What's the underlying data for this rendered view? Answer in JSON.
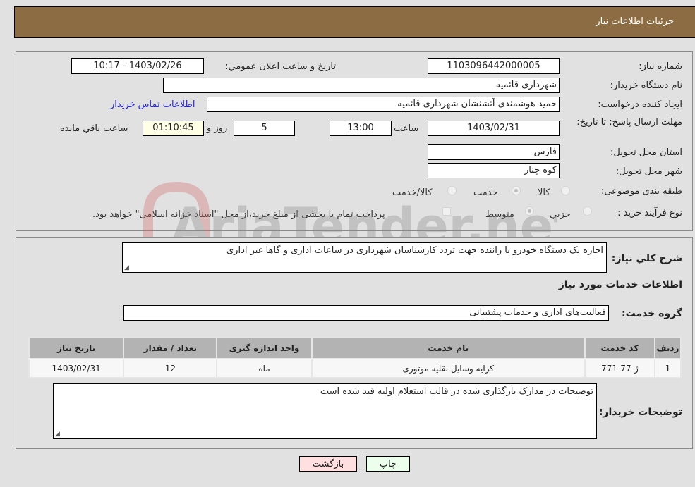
{
  "header": {
    "title": "جزئیات اطلاعات نیاز"
  },
  "fields": {
    "need_number_label": "شماره نیاز:",
    "need_number": "1103096442000005",
    "announce_label": "تاریخ و ساعت اعلان عمومي:",
    "announce_value": "1403/02/26 - 10:17",
    "buyer_name_label": "نام دستگاه خریدار:",
    "buyer_name": "شهرداری قائمیه",
    "creator_label": "ایجاد کننده درخواست:",
    "creator": "حمید هوشمندی آتشنشان شهرداری قائمیه",
    "contact_link": "اطلاعات تماس خریدار",
    "deadline_label": "مهلت ارسال پاسخ: تا تاریخ:",
    "deadline_date": "1403/02/31",
    "time_label": "ساعت",
    "deadline_time": "13:00",
    "days_value": "5",
    "days_label": "روز و",
    "remaining_time": "01:10:45",
    "remaining_label": "ساعت باقي مانده",
    "province_label": "استان محل تحویل:",
    "province": "فارس",
    "city_label": "شهر محل تحویل:",
    "city": "کوه چنار",
    "category_label": "طبقه بندی موضوعی:",
    "category_options": [
      {
        "label": "کالا",
        "checked": false
      },
      {
        "label": "خدمت",
        "checked": true
      },
      {
        "label": "کالا/خدمت",
        "checked": false
      }
    ],
    "process_label": "نوع فرآیند خرید :",
    "process_options": [
      {
        "label": "جزيي",
        "checked": false
      },
      {
        "label": "متوسط",
        "checked": true
      }
    ],
    "treasury_checkbox_label": "پرداخت تمام یا بخشی از مبلغ خرید،از محل \"اسناد خزانه اسلامی\" خواهد بود.",
    "treasury_checked": false
  },
  "details": {
    "summary_label": "شرح کلي نیاز:",
    "summary": "اجاره یک دستگاه خودرو با راننده جهت تردد کارشناسان شهرداری در ساعات اداری و گاها غیر اداری",
    "services_title": "اطلاعات خدمات مورد نیاز",
    "service_group_label": "گروه خدمت:",
    "service_group": "فعالیت‌های اداری و خدمات پشتیبانی",
    "table": {
      "headers": [
        "ردیف",
        "کد خدمت",
        "نام خدمت",
        "واحد اندازه گیری",
        "تعداد / مقدار",
        "تاریخ نیاز"
      ],
      "rows": [
        [
          "1",
          "ژ-77-771",
          "کرایه وسایل نقلیه موتوری",
          "ماه",
          "12",
          "1403/02/31"
        ]
      ]
    },
    "buyer_notes_label": "توضیحات خریدار:",
    "buyer_notes": "توضیحات در مدارک بارگذاری شده در قالب استعلام اولیه قید شده است"
  },
  "buttons": {
    "print": "چاپ",
    "back": "بازگشت"
  },
  "watermark": {
    "text": "AriaTender.net"
  }
}
